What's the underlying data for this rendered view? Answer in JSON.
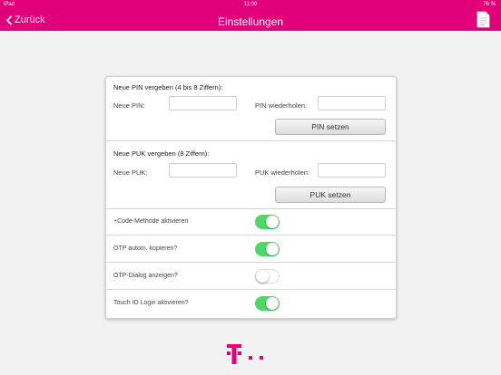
{
  "status": {
    "carrier": "iPad",
    "time": "11:00",
    "battery": "76 %"
  },
  "nav": {
    "back_label": "Zurück",
    "title": "Einstellungen"
  },
  "pin": {
    "title": "Neue PIN vergeben (4 bis 8 Ziffern):",
    "label": "Neue PIN:",
    "value": "",
    "repeat_label": "PIN wiederholen:",
    "repeat_value": "",
    "button": "PIN setzen"
  },
  "puk": {
    "title": "Neue PUK vergeben (8 Ziffern):",
    "label": "Neue PUK:",
    "value": "",
    "repeat_label": "PUK wiederholen:",
    "repeat_value": "",
    "button": "PUK setzen"
  },
  "toggles": [
    {
      "label": "+Code-Methode aktivieren",
      "on": true
    },
    {
      "label": "OTP autom. kopieren?",
      "on": true
    },
    {
      "label": "OTP-Dialog anzeigen?",
      "on": false
    },
    {
      "label": "Touch ID Login aktivieren?",
      "on": true
    }
  ],
  "colors": {
    "brand": "#e2007a",
    "toggle_on": "#4cd964"
  },
  "icons": {
    "back": "chevron-left-icon",
    "document": "document-icon",
    "logo": "telekom-logo"
  }
}
